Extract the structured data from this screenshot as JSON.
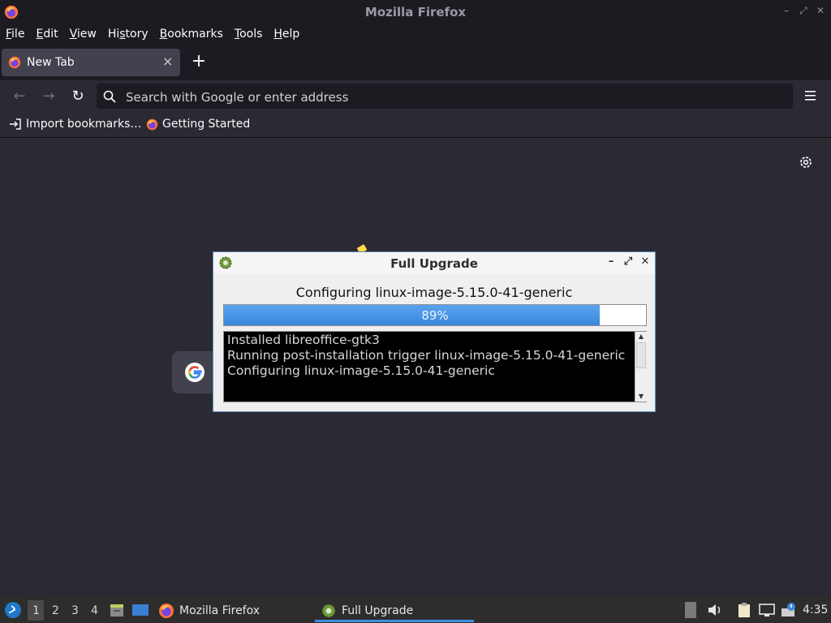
{
  "window": {
    "title": "Mozilla Firefox"
  },
  "menubar": {
    "items": [
      {
        "u": "F",
        "rest": "ile"
      },
      {
        "u": "E",
        "rest": "dit"
      },
      {
        "u": "V",
        "rest": "iew"
      },
      {
        "u": "Hi",
        "pre": "",
        "rest": "story",
        "uindex": 2
      },
      {
        "u": "B",
        "rest": "ookmarks"
      },
      {
        "u": "T",
        "rest": "ools"
      },
      {
        "u": "H",
        "rest": "elp"
      }
    ]
  },
  "tabs": [
    {
      "label": "New Tab"
    }
  ],
  "urlbar": {
    "placeholder": "Search with Google or enter address"
  },
  "bookmarks": [
    {
      "label": "Import bookmarks…"
    },
    {
      "label": "Getting Started"
    }
  ],
  "dialog": {
    "title": "Full Upgrade",
    "status": "Configuring linux-image-5.15.0-41-generic",
    "progress": {
      "value": 0.89,
      "label": "89%"
    },
    "log": [
      "Installed libreoffice-gtk3",
      "Running post-installation trigger linux-image-5.15.0-41-generic",
      "Configuring linux-image-5.15.0-41-generic"
    ]
  },
  "taskbar": {
    "desktops": [
      "1",
      "2",
      "3",
      "4"
    ],
    "tasks": [
      {
        "label": "Mozilla Firefox"
      },
      {
        "label": "Full Upgrade"
      }
    ],
    "clock": "4:35"
  },
  "colors": {
    "accent": "#3a87dd",
    "background": "#2b2a33",
    "chrome": "#1c1b22"
  }
}
